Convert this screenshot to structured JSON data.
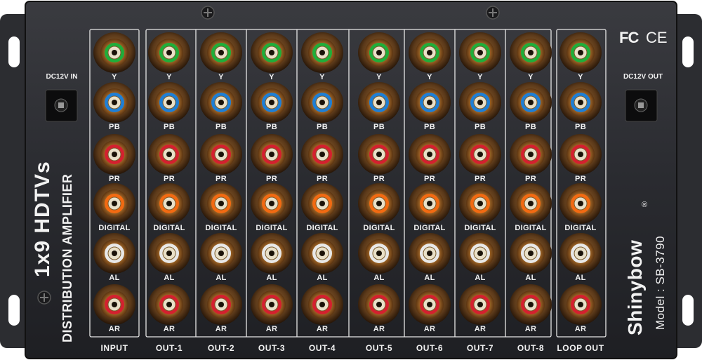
{
  "device": {
    "title_line1": "1x9 HDTVs",
    "title_line2": "DISTRIBUTION AMPLIFIER",
    "brand": "Shinybow",
    "registered_mark": "®",
    "model": "Model : SB-3790",
    "cert_fc": "FC",
    "cert_ce": "CE"
  },
  "power": {
    "input_label": "DC12V IN",
    "output_label": "DC12V OUT"
  },
  "columns": [
    {
      "label": "INPUT"
    },
    {
      "label": "OUT-1"
    },
    {
      "label": "OUT-2"
    },
    {
      "label": "OUT-3"
    },
    {
      "label": "OUT-4"
    },
    {
      "label": "OUT-5"
    },
    {
      "label": "OUT-6"
    },
    {
      "label": "OUT-7"
    },
    {
      "label": "OUT-8"
    },
    {
      "label": "LOOP OUT"
    }
  ],
  "jack_rows": [
    {
      "label": "Y",
      "color": "#1fae3a"
    },
    {
      "label": "PB",
      "color": "#1e7fd6"
    },
    {
      "label": "PR",
      "color": "#d4202f"
    },
    {
      "label": "DIGITAL",
      "color": "#f26a12"
    },
    {
      "label": "AL",
      "color": "#e8e8e8"
    },
    {
      "label": "AR",
      "color": "#d4202f"
    }
  ],
  "colors": {
    "chassis": "#2a2b2f",
    "panel": "#1b1c1f",
    "silkscreen": "#f2f2f2",
    "gold": "#c98b3a"
  }
}
